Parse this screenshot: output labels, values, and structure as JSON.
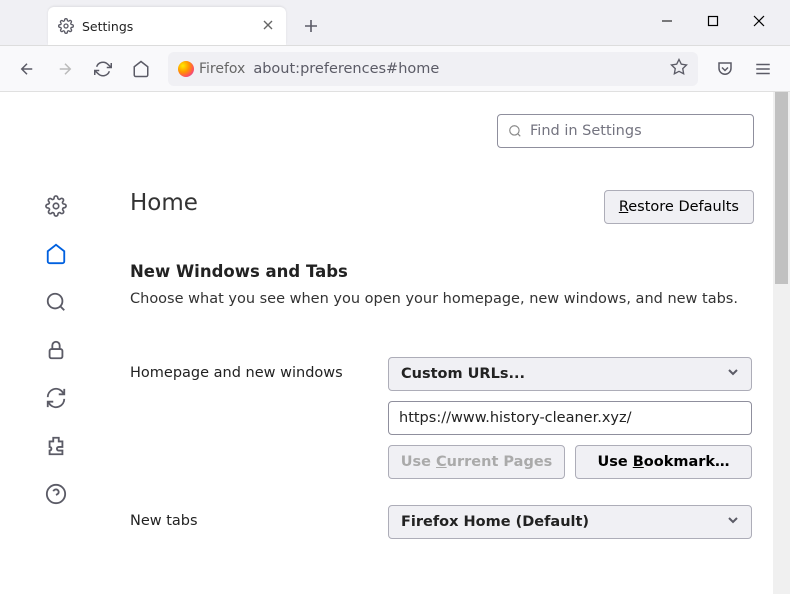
{
  "tabbar": {
    "tab_title": "Settings"
  },
  "toolbar": {
    "firefox_label": "Firefox",
    "url_text": "about:preferences#home"
  },
  "search": {
    "placeholder": "Find in Settings"
  },
  "page": {
    "title": "Home",
    "restore_prefix": "R",
    "restore_rest": "estore Defaults"
  },
  "section": {
    "title": "New Windows and Tabs",
    "desc": "Choose what you see when you open your homepage, new windows, and new tabs."
  },
  "form": {
    "hp_label": "Homepage and new windows",
    "hp_dropdown": "Custom URLs...",
    "hp_url": "https://www.history-cleaner.xyz/",
    "use_current_prefix": "Use ",
    "use_current_u": "C",
    "use_current_rest": "urrent Pages",
    "use_bookmark_prefix": "Use ",
    "use_bookmark_u": "B",
    "use_bookmark_rest": "ookmark…",
    "newtabs_label": "New tabs",
    "newtabs_dropdown": "Firefox Home (Default)"
  }
}
